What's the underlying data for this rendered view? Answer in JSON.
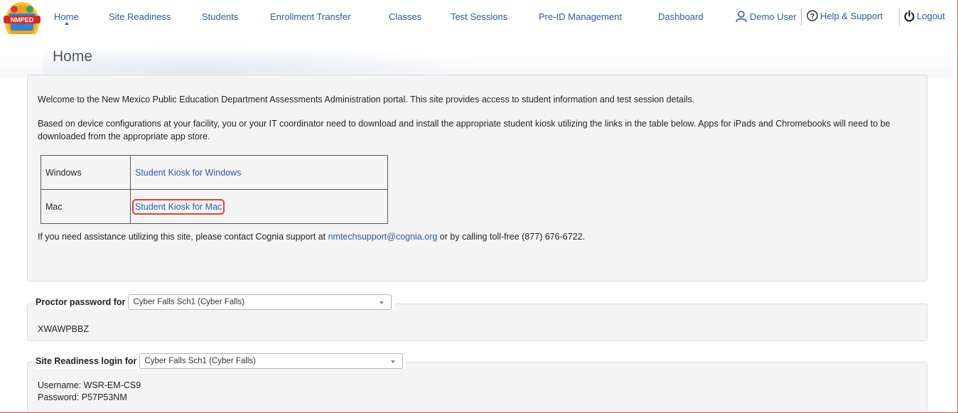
{
  "logo": {
    "text": "NMPED"
  },
  "nav": {
    "items": [
      {
        "label": "Home"
      },
      {
        "label": "Site Readiness"
      },
      {
        "label": "Students"
      },
      {
        "label": "Enrollment Transfer"
      },
      {
        "label": "Classes"
      },
      {
        "label": "Test Sessions"
      },
      {
        "label": "Pre-ID Management"
      },
      {
        "label": "Dashboard"
      }
    ],
    "user_label": "Demo User",
    "help_label": "Help & Support",
    "logout_label": "Logout"
  },
  "page": {
    "title": "Home"
  },
  "welcome": {
    "para1": "Welcome to the New Mexico Public Education Department Assessments Administration portal. This site provides access to student information and test session details.",
    "para2": "Based on device configurations at your facility, you or your IT coordinator need to download and install the appropriate student kiosk utilizing the links in the table below. Apps for iPads and Chromebooks will need to be downloaded from the appropriate app store.",
    "kiosks": [
      {
        "os": "Windows",
        "link": "Student Kiosk for Windows"
      },
      {
        "os": "Mac",
        "link": "Student Kiosk for Mac"
      }
    ],
    "contact_prefix": "If you need assistance utilizing this site, please contact Cognia support at ",
    "contact_email": "nmtechsupport@cognia.org",
    "contact_suffix": " or by calling toll-free (877) 676-6722."
  },
  "proctor": {
    "legend": "Proctor password for",
    "selected": "Cyber Falls Sch1 (Cyber Falls)",
    "value": "XWAWPBBZ"
  },
  "site_readiness": {
    "legend": "Site Readiness login for",
    "selected": "Cyber Falls Sch1 (Cyber Falls)",
    "username_line": "Username: WSR-EM-CS9",
    "password_line": "Password: P57P53NM"
  },
  "colors": {
    "link": "#2a5aa6",
    "highlight": "#e0413c",
    "panel": "#f4f4f4"
  }
}
